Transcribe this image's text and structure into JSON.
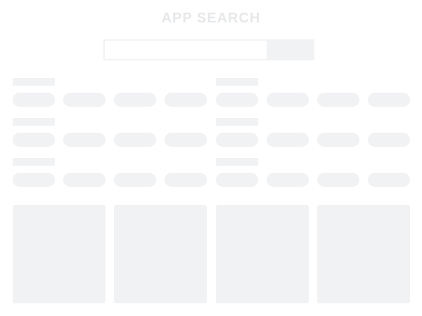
{
  "header": {
    "title": "APP SEARCH"
  },
  "search": {
    "query": "",
    "placeholder": "",
    "button_label": ""
  },
  "filter_groups": [
    {
      "label": "",
      "options": [
        "",
        "",
        "",
        ""
      ]
    },
    {
      "label": "",
      "options": [
        "",
        "",
        "",
        ""
      ]
    },
    {
      "label": "",
      "options": [
        "",
        "",
        "",
        ""
      ]
    },
    {
      "label": "",
      "options": [
        "",
        "",
        "",
        ""
      ]
    },
    {
      "label": "",
      "options": [
        "",
        "",
        "",
        ""
      ]
    },
    {
      "label": "",
      "options": [
        "",
        "",
        "",
        ""
      ]
    }
  ],
  "results": [
    {
      "title": ""
    },
    {
      "title": ""
    },
    {
      "title": ""
    },
    {
      "title": ""
    }
  ],
  "colors": {
    "background": "#ffffff",
    "placeholder_fill": "#f1f2f4",
    "title_text": "#e7e8ea"
  }
}
